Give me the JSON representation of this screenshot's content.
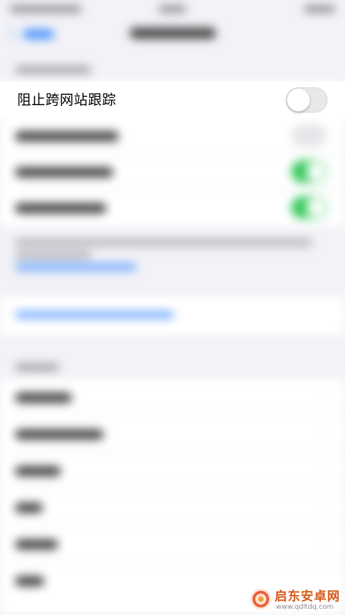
{
  "settings": {
    "prevent_cross_site_tracking": {
      "label": "阻止跨网站跟踪",
      "enabled": false
    }
  },
  "watermark": {
    "title": "启东安卓网",
    "url": "www.qdltdq.com",
    "accent": "#e8603c"
  },
  "colors": {
    "toggle_on": "#34c759",
    "toggle_off": "#e9e9eb",
    "link_blue": "#2e86ff",
    "background": "#f2f2f7"
  }
}
